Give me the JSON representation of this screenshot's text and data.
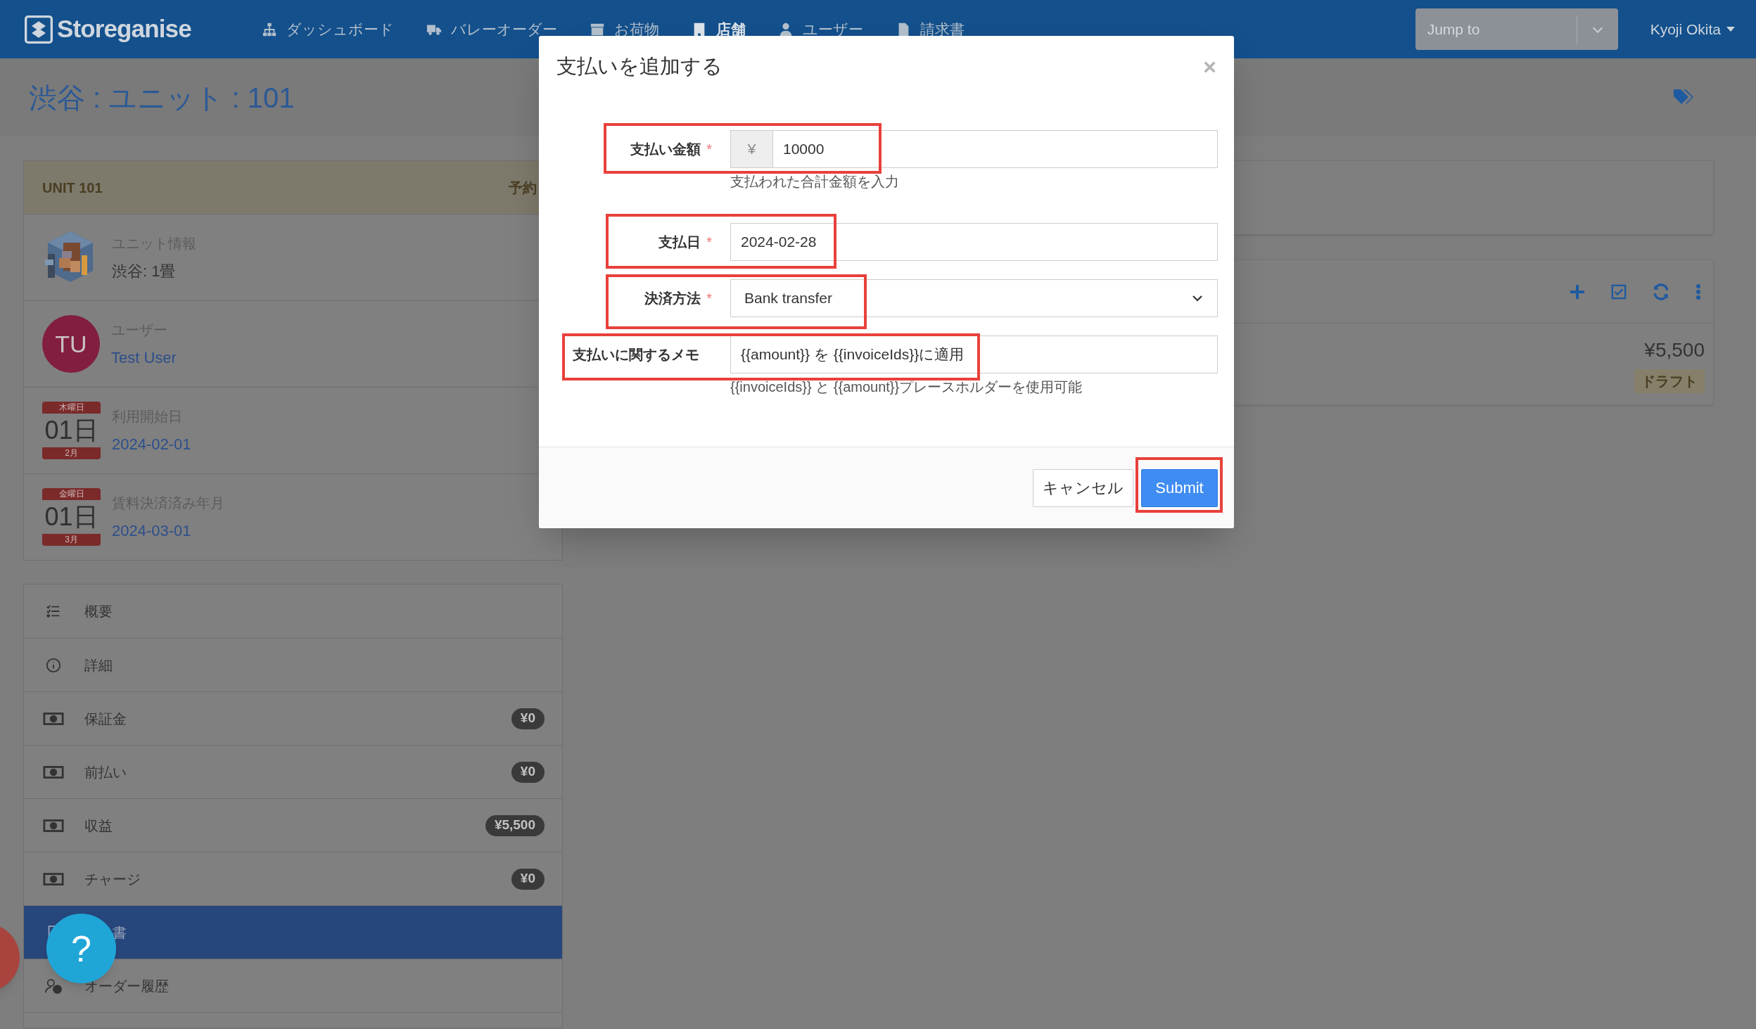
{
  "navbar": {
    "logo": "Storeganise",
    "items": [
      {
        "label": "ダッシュボード",
        "selected": false
      },
      {
        "label": "バレーオーダー",
        "selected": false
      },
      {
        "label": "お荷物",
        "selected": false
      },
      {
        "label": "店舗",
        "selected": true
      },
      {
        "label": "ユーザー",
        "selected": false
      },
      {
        "label": "請求書",
        "selected": false
      }
    ],
    "jump_to": {
      "placeholder": "Jump to"
    },
    "user": "Kyoji Okita"
  },
  "page_title": "渋谷 : ユニット : 101",
  "unit_card": {
    "title": "UNIT 101",
    "status": "予約",
    "rows": [
      {
        "kind": "image",
        "label": "ユニット情報",
        "value": "渋谷: 1畳"
      },
      {
        "kind": "avatar",
        "initials": "TU",
        "label": "ユーザー",
        "value": "Test User"
      },
      {
        "kind": "calendar",
        "weekday": "木曜日",
        "day": "01日",
        "month": "2月",
        "label": "利用開始日",
        "value": "2024-02-01"
      },
      {
        "kind": "calendar",
        "weekday": "金曜日",
        "day": "01日",
        "month": "3月",
        "label": "賃料決済済み年月",
        "value": "2024-03-01"
      }
    ]
  },
  "menu": [
    {
      "label": "概要",
      "selected": false
    },
    {
      "label": "詳細",
      "selected": false
    },
    {
      "label": "保証金",
      "badge": "¥0",
      "selected": false
    },
    {
      "label": "前払い",
      "badge": "¥0",
      "selected": false
    },
    {
      "label": "収益",
      "badge": "¥5,500",
      "selected": false
    },
    {
      "label": "チャージ",
      "badge": "¥0",
      "selected": false
    },
    {
      "label": "書",
      "selected": true
    },
    {
      "label": "オーダー履歴",
      "selected": false
    }
  ],
  "invoices_card": {
    "rows": [
      {
        "amount": "¥5,500",
        "status": "ドラフト"
      }
    ]
  },
  "modal": {
    "title": "支払いを追加する",
    "close": "×",
    "fields": [
      {
        "kind": "money",
        "label": "支払い金額",
        "required_mark": "*",
        "prefix": "¥",
        "value": "10000",
        "help": "支払われた合計金額を入力",
        "highlighted": true
      },
      {
        "kind": "text",
        "label": "支払日",
        "required_mark": "*",
        "value": "2024-02-28",
        "highlighted": true
      },
      {
        "kind": "select",
        "label": "決済方法",
        "required_mark": "*",
        "value": "Bank transfer",
        "highlighted": true
      },
      {
        "kind": "text",
        "label": "支払いに関するメモ",
        "value": "{{amount}} を {{invoiceIds}}に適用",
        "help": "{{invoiceIds}} と {{amount}}プレースホルダーを使用可能",
        "highlighted": true
      }
    ],
    "buttons": [
      {
        "label": "キャンセル",
        "kind": "default"
      },
      {
        "label": "Submit",
        "kind": "primary",
        "highlighted": true
      }
    ]
  },
  "help_button": {
    "label": "?"
  }
}
